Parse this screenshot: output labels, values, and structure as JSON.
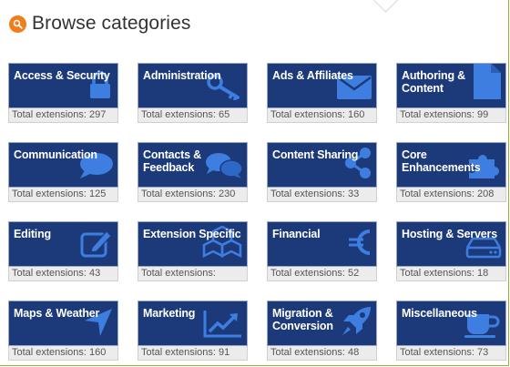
{
  "header": {
    "title": "Browse categories",
    "icon": "search-icon"
  },
  "colors": {
    "accent": "#f07d1a",
    "card_bg": "#1c3a7a",
    "footer_bg": "#ececec",
    "frame": "#8db33a"
  },
  "categories": [
    {
      "name": "Access & Security",
      "count_text": "Total extensions: 297",
      "icon": "lock-icon"
    },
    {
      "name": "Administration",
      "count_text": "Total extensions: 65",
      "icon": "key-icon"
    },
    {
      "name": "Ads & Affiliates",
      "count_text": "Total extensions: 160",
      "icon": "envelope-icon"
    },
    {
      "name": "Authoring &\nContent",
      "count_text": "Total extensions: 99",
      "icon": "document-icon"
    },
    {
      "name": "Communication",
      "count_text": "Total extensions: 125",
      "icon": "speech-bubble-icon"
    },
    {
      "name": "Contacts &\nFeedback",
      "count_text": "Total extensions: 230",
      "icon": "chat-bubbles-icon"
    },
    {
      "name": "Content Sharing",
      "count_text": "Total extensions: 33",
      "icon": "share-icon"
    },
    {
      "name": "Core Enhancements",
      "count_text": "Total extensions: 208",
      "icon": "puzzle-icon"
    },
    {
      "name": "Editing",
      "count_text": "Total extensions: 43",
      "icon": "edit-icon"
    },
    {
      "name": "Extension Specific",
      "count_text": "Total extensions:",
      "icon": "cubes-icon"
    },
    {
      "name": "Financial",
      "count_text": "Total extensions: 52",
      "icon": "euro-icon"
    },
    {
      "name": "Hosting & Servers",
      "count_text": "Total extensions: 18",
      "icon": "server-icon"
    },
    {
      "name": "Maps & Weather",
      "count_text": "Total extensions: 160",
      "icon": "location-arrow-icon"
    },
    {
      "name": "Marketing",
      "count_text": "Total extensions: 91",
      "icon": "line-chart-icon"
    },
    {
      "name": "Migration &\nConversion",
      "count_text": "Total extensions: 48",
      "icon": "rocket-icon"
    },
    {
      "name": "Miscellaneous",
      "count_text": "Total extensions: 73",
      "icon": "coffee-cup-icon"
    }
  ]
}
